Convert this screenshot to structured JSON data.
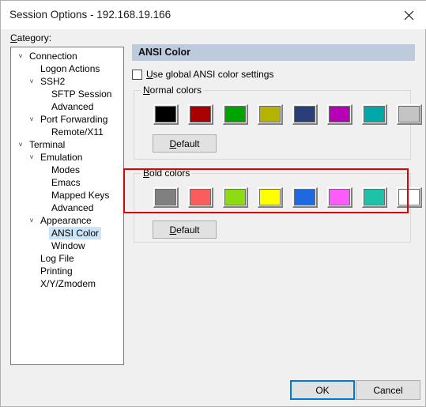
{
  "window": {
    "title": "Session Options - 192.168.19.166",
    "close_icon": "close-icon"
  },
  "category": {
    "label": "Category:",
    "label_mnemonic": "C",
    "tree": [
      {
        "label": "Connection",
        "level": 0,
        "expander": "˅",
        "selected": false
      },
      {
        "label": "Logon Actions",
        "level": 1,
        "expander": "",
        "selected": false
      },
      {
        "label": "SSH2",
        "level": 1,
        "expander": "˅",
        "selected": false
      },
      {
        "label": "SFTP Session",
        "level": 2,
        "expander": "",
        "selected": false
      },
      {
        "label": "Advanced",
        "level": 2,
        "expander": "",
        "selected": false
      },
      {
        "label": "Port Forwarding",
        "level": 1,
        "expander": "˅",
        "selected": false
      },
      {
        "label": "Remote/X11",
        "level": 2,
        "expander": "",
        "selected": false
      },
      {
        "label": "Terminal",
        "level": 0,
        "expander": "˅",
        "selected": false
      },
      {
        "label": "Emulation",
        "level": 1,
        "expander": "˅",
        "selected": false
      },
      {
        "label": "Modes",
        "level": 2,
        "expander": "",
        "selected": false
      },
      {
        "label": "Emacs",
        "level": 2,
        "expander": "",
        "selected": false
      },
      {
        "label": "Mapped Keys",
        "level": 2,
        "expander": "",
        "selected": false
      },
      {
        "label": "Advanced",
        "level": 2,
        "expander": "",
        "selected": false
      },
      {
        "label": "Appearance",
        "level": 1,
        "expander": "˅",
        "selected": false
      },
      {
        "label": "ANSI Color",
        "level": 2,
        "expander": "",
        "selected": true
      },
      {
        "label": "Window",
        "level": 2,
        "expander": "",
        "selected": false
      },
      {
        "label": "Log File",
        "level": 1,
        "expander": "",
        "selected": false
      },
      {
        "label": "Printing",
        "level": 1,
        "expander": "",
        "selected": false
      },
      {
        "label": "X/Y/Zmodem",
        "level": 1,
        "expander": "",
        "selected": false
      }
    ]
  },
  "panel": {
    "header": "ANSI Color",
    "use_global": {
      "label_prefix": "",
      "mnemonic": "U",
      "label_rest": "se global ANSI color settings",
      "checked": false
    },
    "normal_colors": {
      "title_mnemonic": "N",
      "title_rest": "ormal colors",
      "swatches": [
        {
          "name": "black",
          "hex": "#000000"
        },
        {
          "name": "red",
          "hex": "#aa0000"
        },
        {
          "name": "green",
          "hex": "#00a400"
        },
        {
          "name": "yellow",
          "hex": "#b3b300"
        },
        {
          "name": "blue",
          "hex": "#2a3f7a"
        },
        {
          "name": "magenta",
          "hex": "#b500b5"
        },
        {
          "name": "cyan",
          "hex": "#00a8a8"
        },
        {
          "name": "white",
          "hex": "#c4c4c4"
        }
      ],
      "default_button": {
        "mnemonic": "D",
        "rest": "efault"
      }
    },
    "bold_colors": {
      "title_mnemonic": "B",
      "title_rest": "old colors",
      "swatches": [
        {
          "name": "bright-black",
          "hex": "#808080"
        },
        {
          "name": "bright-red",
          "hex": "#fb5c5c"
        },
        {
          "name": "bright-green",
          "hex": "#8ddb13"
        },
        {
          "name": "bright-yellow",
          "hex": "#ffff00"
        },
        {
          "name": "bright-blue",
          "hex": "#1f69e0"
        },
        {
          "name": "bright-magenta",
          "hex": "#fb5cfb"
        },
        {
          "name": "bright-cyan",
          "hex": "#1ec2a8"
        },
        {
          "name": "bright-white",
          "hex": "#ffffff"
        }
      ],
      "default_button": {
        "mnemonic": "D",
        "rest": "efault"
      }
    },
    "annotation_color": "#e00000"
  },
  "footer": {
    "ok_label": "OK",
    "cancel_label": "Cancel",
    "accent_color": "#0078d7"
  }
}
